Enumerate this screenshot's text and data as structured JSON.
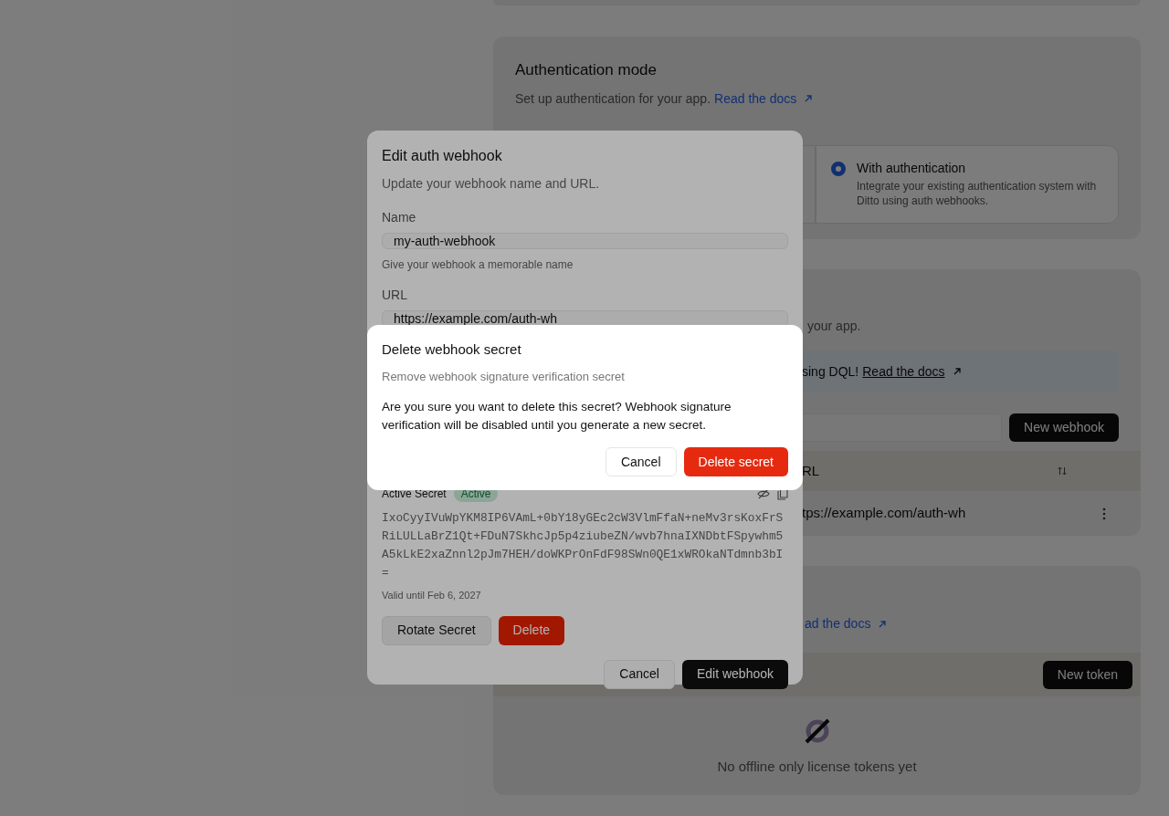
{
  "auth_mode": {
    "title": "Authentication mode",
    "description": "Set up authentication for your app.",
    "docs_link": "Read the docs",
    "options": [
      {
        "title": "With authentication",
        "description": "Integrate your existing authentication system with Ditto using auth webhooks.",
        "selected": true
      }
    ]
  },
  "webhooks": {
    "description": "your app.",
    "banner_text": "sing DQL!",
    "banner_link": "Read the docs",
    "new_button": "New webhook",
    "table": {
      "columns": [
        {
          "label": "RL"
        }
      ],
      "rows": [
        {
          "url": "tps://example.com/auth-wh"
        }
      ]
    }
  },
  "licenses": {
    "docs_link": "ad the docs",
    "new_button": "New token",
    "empty_text": "No offline only license tokens yet"
  },
  "edit_dialog": {
    "title": "Edit auth webhook",
    "description": "Update your webhook name and URL.",
    "name_label": "Name",
    "name_value": "my-auth-webhook",
    "name_hint": "Give your webhook a memorable name",
    "url_label": "URL",
    "url_value": "https://example.com/auth-wh",
    "secret": {
      "label": "Active Secret",
      "badge": "Active",
      "value": "IxoCyyIVuWpYKM8IP6VAmL+0bY18yGEc2cW3VlmFfaN+neMv3rsKoxFrSRiLULLaBrZ1Qt+FDuN7SkhcJp5p4ziubeZN/wvb7hnaIXNDbtFSpywhm5A5kLkE2xaZnnl2pJm7HEH/doWKPrOnFdF98SWn0QE1xWROkaNTdmnb3bI=",
      "valid": "Valid until Feb 6, 2027",
      "rotate_button": "Rotate Secret",
      "delete_button": "Delete"
    },
    "cancel_button": "Cancel",
    "submit_button": "Edit webhook"
  },
  "delete_dialog": {
    "title": "Delete webhook secret",
    "description": "Remove webhook signature verification secret",
    "message": "Are you sure you want to delete this secret? Webhook signature verification will be disabled until you generate a new secret.",
    "cancel_button": "Cancel",
    "confirm_button": "Delete secret"
  }
}
